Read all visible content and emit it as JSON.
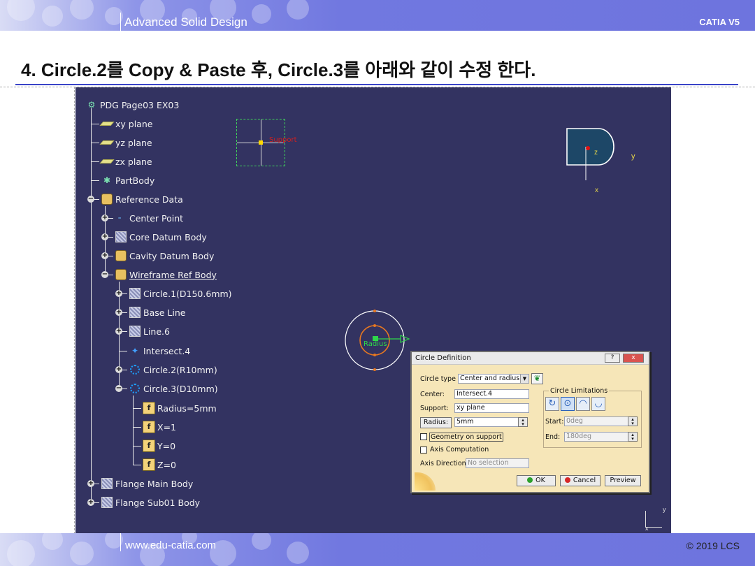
{
  "header": {
    "title": "Advanced Solid Design",
    "product": "CATIA V5"
  },
  "slide": {
    "title": "4. Circle.2를 Copy & Paste 후, Circle.3를 아래와 같이 수정 한다."
  },
  "footer": {
    "website": "www.edu-catia.com",
    "copyright": "© 2019 LCS"
  },
  "tree": {
    "root": "PDG Page03 EX03",
    "items": [
      {
        "label": "xy plane",
        "icon": "plane-icon"
      },
      {
        "label": "yz plane",
        "icon": "plane-icon"
      },
      {
        "label": "zx plane",
        "icon": "plane-icon"
      },
      {
        "label": "PartBody",
        "icon": "gear-icon"
      },
      {
        "label": "Reference Data",
        "icon": "geometrical-set-icon"
      },
      {
        "label": "Center Point",
        "icon": "point-icon"
      },
      {
        "label": "Core Datum Body",
        "icon": "body-icon"
      },
      {
        "label": "Cavity Datum Body",
        "icon": "geometrical-set-icon"
      },
      {
        "label": "Wireframe Ref Body",
        "icon": "geometrical-set-icon"
      },
      {
        "label": "Circle.1(D150.6mm)",
        "icon": "body-icon"
      },
      {
        "label": "Base Line",
        "icon": "body-icon"
      },
      {
        "label": "Line.6",
        "icon": "body-icon"
      },
      {
        "label": "Intersect.4",
        "icon": "intersect-icon"
      },
      {
        "label": "Circle.2(R10mm)",
        "icon": "circle-icon"
      },
      {
        "label": "Circle.3(D10mm)",
        "icon": "circle-icon"
      },
      {
        "label": "Radius=5mm",
        "icon": "parameter-icon"
      },
      {
        "label": "X=1",
        "icon": "parameter-icon"
      },
      {
        "label": "Y=0",
        "icon": "parameter-icon"
      },
      {
        "label": "Z=0",
        "icon": "parameter-icon"
      },
      {
        "label": "Flange Main Body",
        "icon": "body-icon"
      },
      {
        "label": "Flange Sub01 Body",
        "icon": "body-icon"
      }
    ]
  },
  "viewport": {
    "sketch_label": "Support",
    "radius_label": "Radius",
    "axis": {
      "z": "z",
      "y": "y",
      "x": "x"
    },
    "compass": {
      "y": "y",
      "x": "x"
    }
  },
  "dialog": {
    "title": "Circle Definition",
    "help_btn": "?",
    "close_btn": "x",
    "circle_type_label": "Circle type :",
    "circle_type_value": "Center and radius",
    "center_label": "Center:",
    "center_value": "Intersect.4",
    "support_label": "Support:",
    "support_value": "xy plane",
    "radius_btn": "Radius:",
    "radius_value": "5mm",
    "geometry_on_support": "Geometry on support",
    "axis_computation": "Axis Computation",
    "axis_direction_label": "Axis Direction:",
    "axis_direction_placeholder": "No selection",
    "limitations_label": "Circle Limitations",
    "start_label": "Start:",
    "start_value": "0deg",
    "end_label": "End:",
    "end_value": "180deg",
    "ok": "OK",
    "cancel": "Cancel",
    "preview": "Preview"
  }
}
